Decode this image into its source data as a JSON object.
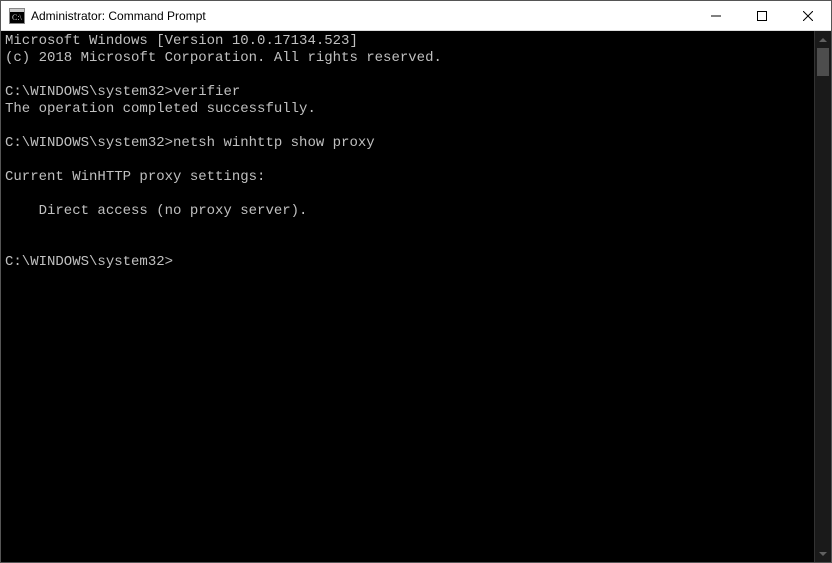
{
  "window": {
    "title": "Administrator: Command Prompt"
  },
  "terminal": {
    "lines": {
      "l0": "Microsoft Windows [Version 10.0.17134.523]",
      "l1": "(c) 2018 Microsoft Corporation. All rights reserved.",
      "l2": "",
      "l3_prompt": "C:\\WINDOWS\\system32>",
      "l3_cmd": "verifier",
      "l4": "The operation completed successfully.",
      "l5": "",
      "l6_prompt": "C:\\WINDOWS\\system32>",
      "l6_cmd": "netsh winhttp show proxy",
      "l7": "",
      "l8": "Current WinHTTP proxy settings:",
      "l9": "",
      "l10": "    Direct access (no proxy server).",
      "l11": "",
      "l12": "",
      "l13_prompt": "C:\\WINDOWS\\system32>"
    }
  }
}
